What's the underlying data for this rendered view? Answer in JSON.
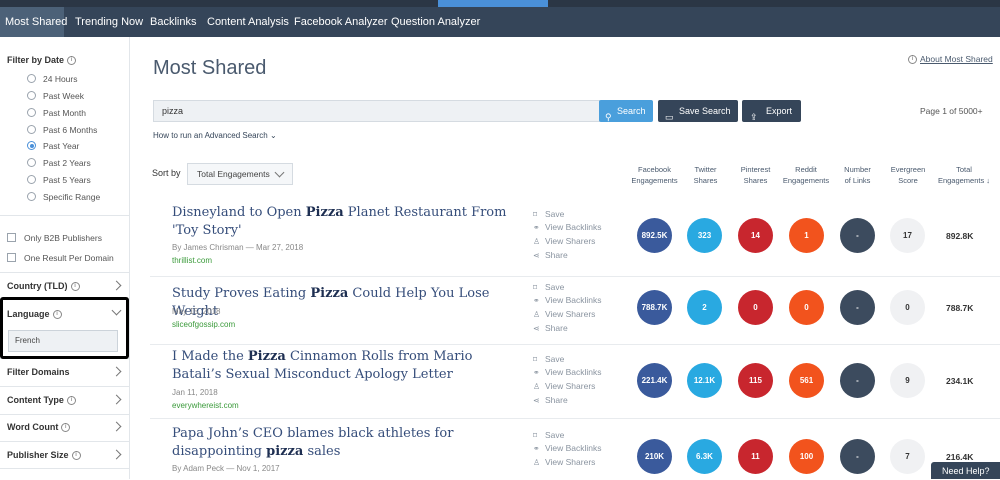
{
  "nav": {
    "items": [
      "Most Shared",
      "Trending Now",
      "Backlinks",
      "Content Analysis",
      "Facebook Analyzer",
      "Question Analyzer"
    ]
  },
  "sidebar": {
    "filter_by_date": "Filter by Date",
    "date_options": [
      "24 Hours",
      "Past Week",
      "Past Month",
      "Past 6 Months",
      "Past Year",
      "Past 2 Years",
      "Past 5 Years",
      "Specific Range"
    ],
    "selected_date": "Past Year",
    "checkboxes": [
      "Only B2B Publishers",
      "One Result Per Domain"
    ],
    "country": "Country (TLD)",
    "language": "Language",
    "language_value": "French",
    "filter_domains": "Filter Domains",
    "content_type": "Content Type",
    "word_count": "Word Count",
    "publisher_size": "Publisher Size"
  },
  "main": {
    "title": "Most Shared",
    "about_link": "About Most Shared",
    "search_value": "pizza",
    "search_button": "Search",
    "save_search_button": "Save Search",
    "export_button": "Export",
    "page_info": "Page 1 of 5000+",
    "advanced_link": "How to run an Advanced Search",
    "sort_label": "Sort by",
    "sort_value": "Total Engagements"
  },
  "columns": [
    {
      "l1": "Facebook",
      "l2": "Engagements"
    },
    {
      "l1": "Twitter",
      "l2": "Shares"
    },
    {
      "l1": "Pinterest",
      "l2": "Shares"
    },
    {
      "l1": "Reddit",
      "l2": "Engagements"
    },
    {
      "l1": "Number",
      "l2": "of Links"
    },
    {
      "l1": "Evergreen",
      "l2": "Score"
    },
    {
      "l1": "Total",
      "l2": "Engagements ↓"
    }
  ],
  "actions": [
    "Save",
    "View Backlinks",
    "View Sharers",
    "Share"
  ],
  "colors": {
    "facebook": "#3a5a9c",
    "twitter": "#29a9e1",
    "pinterest": "#c8262e",
    "reddit": "#f2531d",
    "links": "#3c4b5e",
    "evergreen": "#f0f1f3",
    "accent": "#4a9fdc",
    "nav": "#354559"
  },
  "articles": [
    {
      "title_pre": "Disneyland to Open ",
      "title_bold": "Pizza",
      "title_post": " Planet Restaurant From 'Toy Story'",
      "meta": "By James Chrisman — Mar 27, 2018",
      "url": "thrillist.com",
      "facebook": "892.5K",
      "twitter": "323",
      "pinterest": "14",
      "reddit": "1",
      "links": "-",
      "evergreen": "17",
      "total": "892.8K"
    },
    {
      "title_pre": "Study Proves Eating ",
      "title_bold": "Pizza",
      "title_post": " Could Help You Lose Weight",
      "meta": "May 15, 2018",
      "url": "sliceofgossip.com",
      "facebook": "788.7K",
      "twitter": "2",
      "pinterest": "0",
      "reddit": "0",
      "links": "-",
      "evergreen": "0",
      "total": "788.7K"
    },
    {
      "title_pre": "I Made the ",
      "title_bold": "Pizza",
      "title_post": " Cinnamon Rolls from Mario Batali’s Sexual Misconduct Apology Letter",
      "meta": "Jan 11, 2018",
      "url": "everywhereist.com",
      "facebook": "221.4K",
      "twitter": "12.1K",
      "pinterest": "115",
      "reddit": "561",
      "links": "-",
      "evergreen": "9",
      "total": "234.1K"
    },
    {
      "title_pre": "Papa John’s CEO blames black athletes for disappointing ",
      "title_bold": "pizza",
      "title_post": " sales",
      "meta": "By Adam Peck — Nov 1, 2017",
      "url": "",
      "facebook": "210K",
      "twitter": "6.3K",
      "pinterest": "11",
      "reddit": "100",
      "links": "-",
      "evergreen": "7",
      "total": "216.4K"
    }
  ],
  "help_button": "Need Help?"
}
